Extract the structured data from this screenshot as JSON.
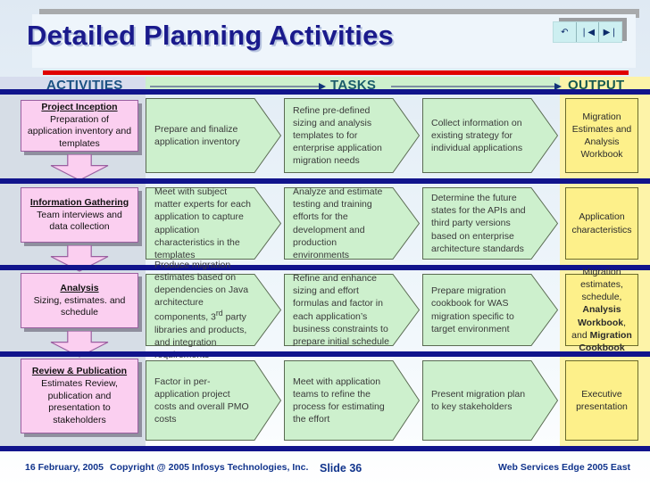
{
  "title": "Detailed Planning Activities",
  "nav": {
    "buttons": [
      {
        "name": "undo-icon",
        "glyph": "↶"
      },
      {
        "name": "previous-icon",
        "glyph": "❘◀"
      },
      {
        "name": "next-icon",
        "glyph": "▶❘"
      }
    ]
  },
  "header": {
    "activities": "ACTIVITIES",
    "tasks": "TASKS",
    "output": "OUTPUT"
  },
  "rows": [
    {
      "stage_title": "Project Inception",
      "stage_desc": "Preparation of application inventory and templates",
      "tasks": [
        "Prepare and finalize application inventory",
        "Refine pre-defined sizing and analysis templates to for enterprise application migration needs",
        "Collect information on existing strategy for individual applications"
      ],
      "output": "Migration Estimates and Analysis Workbook"
    },
    {
      "stage_title": "Information Gathering",
      "stage_desc": "Team interviews and data collection",
      "tasks": [
        "Meet with subject matter experts for each application to capture application characteristics in the templates",
        "Analyze and estimate testing and training efforts for the development and production environments",
        "Determine the future states for the APIs and third party versions based on enterprise architecture  standards"
      ],
      "output": "Application characteristics"
    },
    {
      "stage_title": "Analysis",
      "stage_desc": "Sizing, estimates. and schedule",
      "tasks": [
        "Produce migration estimates based on dependencies on Java architecture components, 3rd party libraries and products, and integration requirements",
        "Refine and enhance sizing and effort formulas and factor in each application’s business constraints to prepare initial schedule",
        "Prepare migration cookbook for WAS migration specific to target environment"
      ],
      "output_rich": [
        {
          "t": "Migration estimates, schedule, ",
          "b": false
        },
        {
          "t": "Analysis Workbook",
          "b": true
        },
        {
          "t": ", and ",
          "b": false
        },
        {
          "t": "Migration Cookbook",
          "b": true
        }
      ]
    },
    {
      "stage_title": "Review & Publication",
      "stage_desc": "Estimates Review, publication and presentation to stakeholders",
      "tasks": [
        "Factor in per-application project costs and overall PMO costs",
        "Meet with application teams to refine the process for estimating the effort",
        "Present migration plan to key stakeholders"
      ],
      "output": "Executive presentation"
    }
  ],
  "footer": {
    "date": "16 February, 2005",
    "copyright": "Copyright @ 2005 Infosys Technologies, Inc.",
    "slide": "Slide 36",
    "event": "Web Services Edge 2005 East"
  },
  "colors": {
    "navy": "#11148c",
    "red_rule": "#e00000",
    "stage_fill": "#fbcff0",
    "task_fill": "#cdf0cd",
    "output_fill": "#fdf08a",
    "title": "#1a1a8c"
  }
}
